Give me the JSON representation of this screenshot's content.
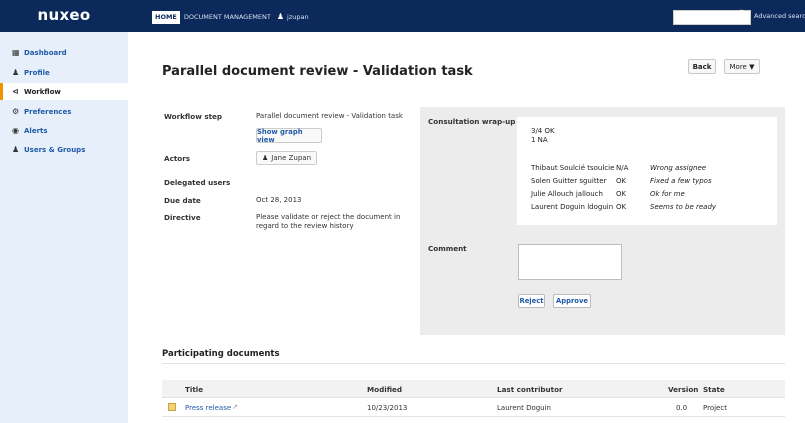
{
  "header": {
    "logo": "nuxeo",
    "nav_home": "HOME",
    "nav_doc_management": "DOCUMENT MANAGEMENT",
    "nav_user": "jzupan",
    "search_placeholder": "",
    "advanced_search": "Advanced search"
  },
  "sidebar": {
    "items": [
      {
        "label": "Dashboard",
        "icon": "grid-icon"
      },
      {
        "label": "Profile",
        "icon": "user-icon"
      },
      {
        "label": "Workflow",
        "icon": "share-icon",
        "active": true
      },
      {
        "label": "Preferences",
        "icon": "gear-icon"
      },
      {
        "label": "Alerts",
        "icon": "broadcast-icon"
      },
      {
        "label": "Users & Groups",
        "icon": "users-icon"
      }
    ]
  },
  "page": {
    "title": "Parallel document review - Validation task",
    "back_label": "Back",
    "more_label": "More ▼"
  },
  "summary": {
    "workflow_step_label": "Workflow step",
    "workflow_step_value": "Parallel document review - Validation task",
    "show_graph_label": "Show graph view",
    "actors_label": "Actors",
    "actor_name": "Jane Zupan",
    "delegated_users_label": "Delegated users",
    "due_date_label": "Due date",
    "due_date_value": "Oct 28, 2013",
    "directive_label": "Directive",
    "directive_value": "Please validate or reject the document in regard to the review history"
  },
  "wrapup": {
    "label": "Consultation wrap-up",
    "tally_ok": "3/4 OK",
    "tally_na": "1 NA",
    "reviews": [
      {
        "name": "Thibaut Soulcié tsoulcie",
        "status": "N/A",
        "note": "Wrong assignee"
      },
      {
        "name": "Solen Guitter sguitter",
        "status": "OK",
        "note": "Fixed a few typos"
      },
      {
        "name": "Julie Allouch jallouch",
        "status": "OK",
        "note": "Ok for me"
      },
      {
        "name": "Laurent Doguin ldoguin",
        "status": "OK",
        "note": "Seems to be ready"
      }
    ]
  },
  "comment": {
    "label": "Comment",
    "value": "",
    "reject_label": "Reject",
    "approve_label": "Approve"
  },
  "documents": {
    "section_title": "Participating documents",
    "columns": [
      "Title",
      "Modified",
      "Last contributor",
      "Version",
      "State"
    ],
    "rows": [
      {
        "title": "Press release",
        "modified": "10/23/2013",
        "contributor": "Laurent Doguin",
        "version": "0.0",
        "state": "Project"
      }
    ]
  }
}
